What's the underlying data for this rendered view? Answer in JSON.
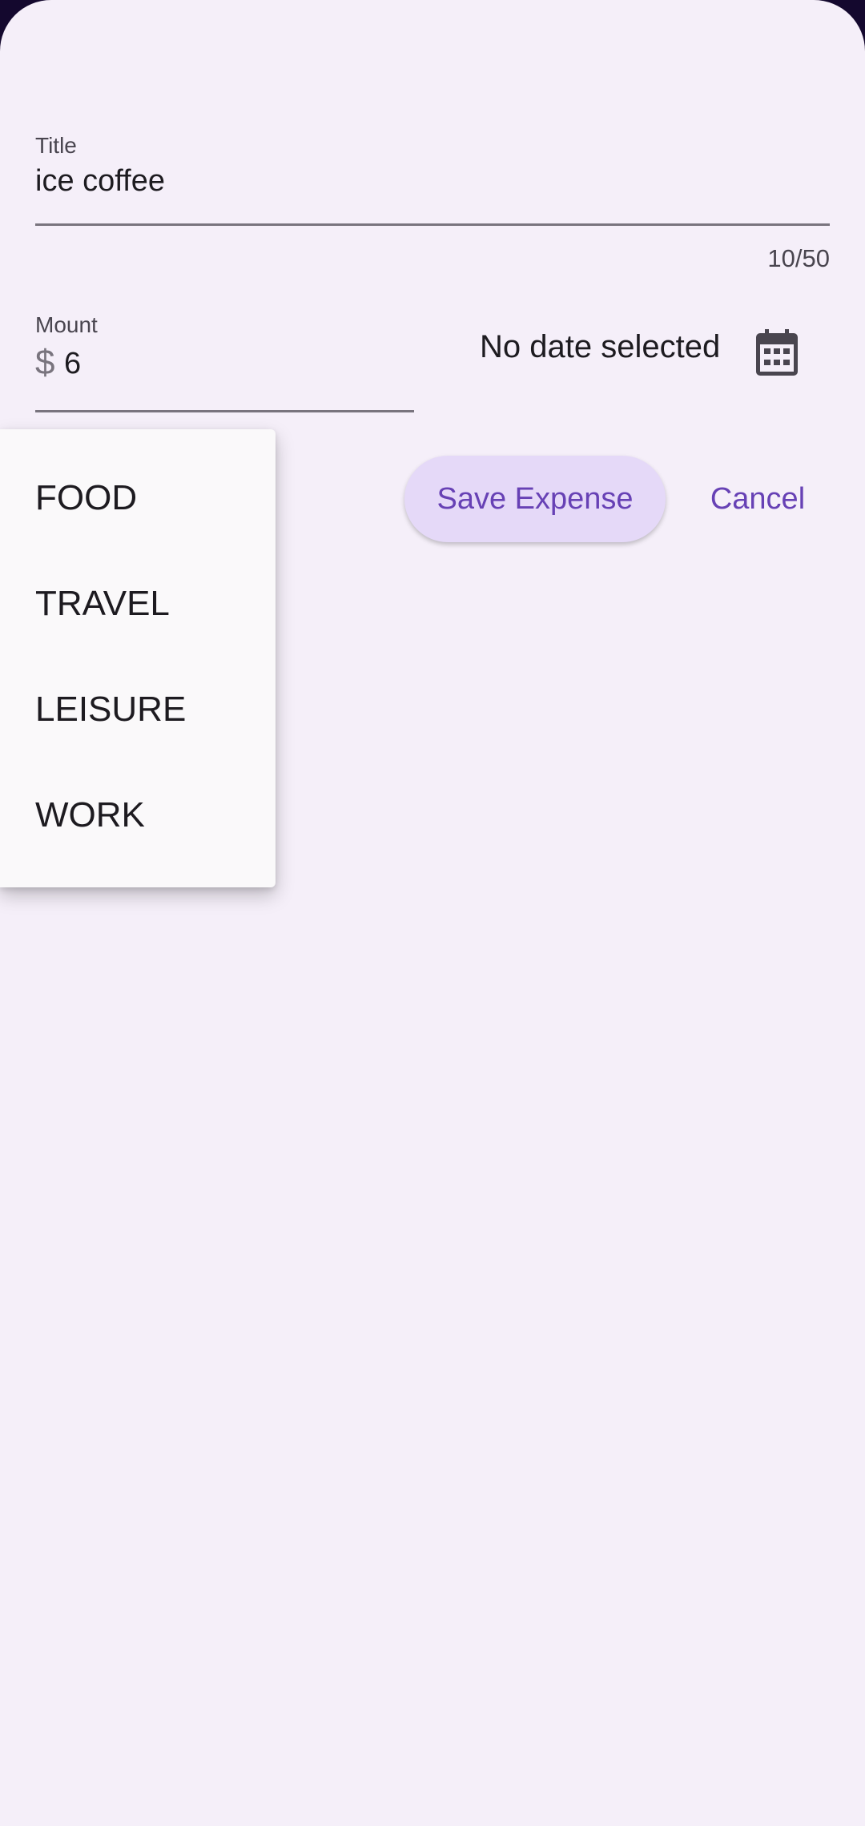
{
  "form": {
    "title_field": {
      "label": "Title",
      "value": "ice coffee",
      "counter": "10/50"
    },
    "amount_field": {
      "label": "Mount",
      "prefix": "$",
      "value": "6"
    },
    "date": {
      "text": "No date selected",
      "icon": "calendar-icon"
    },
    "actions": {
      "save_label": "Save Expense",
      "cancel_label": "Cancel"
    }
  },
  "category_dropdown": {
    "options": [
      "FOOD",
      "TRAVEL",
      "LEISURE",
      "WORK"
    ]
  },
  "colors": {
    "sheet_background": "#f5eff9",
    "accent": "#6741b5",
    "button_fill": "#e5d9f8",
    "menu_background": "#faf9fa",
    "outer_background": "#14082e"
  }
}
